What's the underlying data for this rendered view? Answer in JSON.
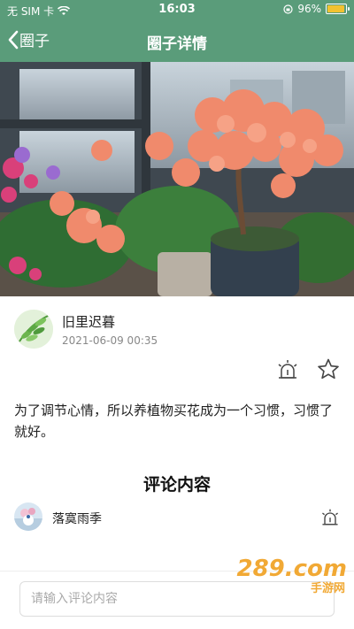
{
  "status_bar": {
    "carrier": "无 SIM 卡",
    "time": "16:03",
    "battery": "96%",
    "battery_level": 0.96
  },
  "nav": {
    "back_label": "圈子",
    "title": "圈子详情"
  },
  "post": {
    "author_name": "旧里迟暮",
    "timestamp": "2021-06-09 00:35",
    "content": "为了调节心情，所以养植物买花成为一个习惯，习惯了就好。",
    "image_icon": "potted-bougainvillea-photo"
  },
  "comments": {
    "section_title": "评论内容",
    "items": [
      {
        "author": "落寞雨季"
      }
    ]
  },
  "comment_input": {
    "placeholder": "请输入评论内容"
  },
  "watermark": {
    "main": "289.com",
    "sub": "手游网"
  },
  "colors": {
    "header": "#5a9c7a",
    "battery": "#f2c230",
    "watermark": "#f0a020"
  }
}
